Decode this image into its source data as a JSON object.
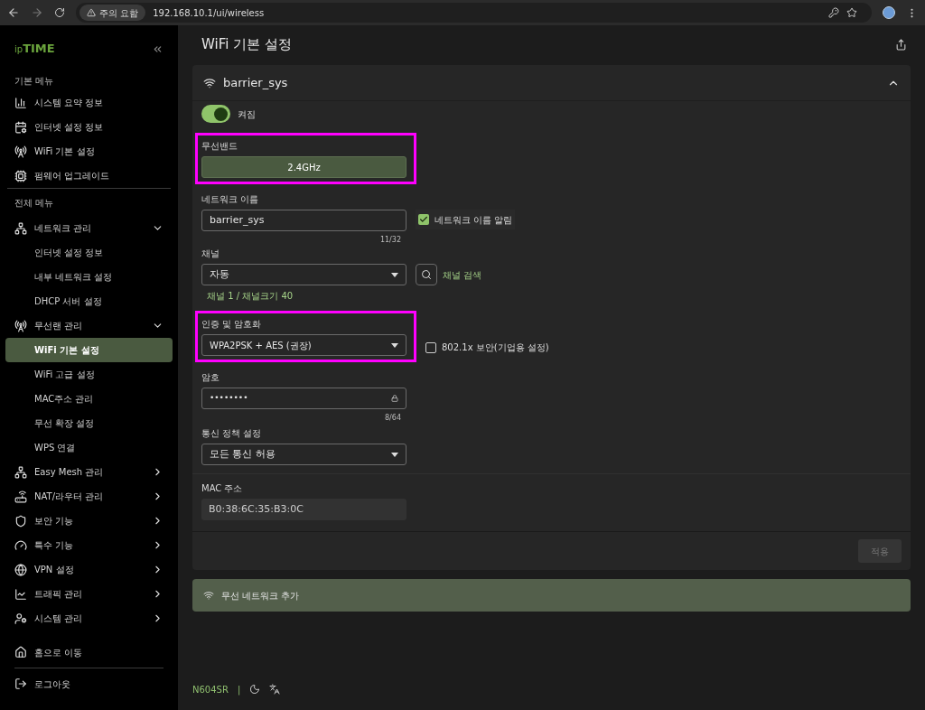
{
  "browser": {
    "warning": "주의 요함",
    "url": "192.168.10.1/ui/wireless"
  },
  "sidebar": {
    "logo_prefix": "ip",
    "logo": "TIME",
    "sections": [
      {
        "title": "기본 메뉴",
        "items": [
          {
            "label": "시스템 요약 정보",
            "selected": false
          },
          {
            "label": "인터넷 설정 정보",
            "selected": false
          },
          {
            "label": "WiFi 기본 설정",
            "selected": false
          },
          {
            "label": "펌웨어 업그레이드",
            "selected": false
          }
        ]
      },
      {
        "title": "전체 메뉴",
        "items": [
          {
            "label": "네트워크 관리",
            "selected": false,
            "expanded": true,
            "children": [
              {
                "label": "인터넷 설정 정보",
                "selected": false
              },
              {
                "label": "내부 네트워크 설정",
                "selected": false
              },
              {
                "label": "DHCP 서버 설정",
                "selected": false
              }
            ]
          },
          {
            "label": "무선랜 관리",
            "selected": false,
            "expanded": true,
            "children": [
              {
                "label": "WiFi 기본 설정",
                "selected": true
              },
              {
                "label": "WiFi 고급 설정",
                "selected": false
              },
              {
                "label": "MAC주소 관리",
                "selected": false
              },
              {
                "label": "무선 확장 설정",
                "selected": false
              },
              {
                "label": "WPS 연결",
                "selected": false
              }
            ]
          },
          {
            "label": "Easy Mesh 관리",
            "selected": false,
            "expanded": false
          },
          {
            "label": "NAT/라우터 관리",
            "selected": false,
            "expanded": false
          },
          {
            "label": "보안 기능",
            "selected": false,
            "expanded": false
          },
          {
            "label": "특수 기능",
            "selected": false,
            "expanded": false
          },
          {
            "label": "VPN 설정",
            "selected": false,
            "expanded": false
          },
          {
            "label": "트래픽 관리",
            "selected": false,
            "expanded": false
          },
          {
            "label": "시스템 관리",
            "selected": false,
            "expanded": false
          }
        ]
      }
    ],
    "bottom": [
      {
        "label": "홈으로 이동"
      },
      {
        "label": "로그아웃"
      }
    ]
  },
  "footer": {
    "model": "N604SR",
    "separator": "|"
  },
  "page": {
    "title": "WiFi 기본 설정"
  },
  "network": {
    "name": "barrier_sys",
    "expanded": true,
    "toggle": {
      "on": true,
      "label": "켜짐"
    },
    "band": {
      "label": "무선밴드",
      "value": "2.4GHz",
      "highlighted": true
    },
    "ssid": {
      "label": "네트워크 이름",
      "value": "barrier_sys",
      "counter": "11/32",
      "broadcast": {
        "label": "네트워크 이름 알림",
        "checked": true
      }
    },
    "channel": {
      "label": "채널",
      "value": "자동",
      "search_label": "채널 검색",
      "info": "채널 1 / 채널크기 40"
    },
    "auth": {
      "label": "인증 및 암호화",
      "value": "WPA2PSK + AES (권장)",
      "highlighted": true,
      "enterprise": {
        "label": "802.1x 보안(기업용 설정)",
        "checked": false
      }
    },
    "password": {
      "label": "암호",
      "value": "••••••••",
      "counter": "8/64"
    },
    "policy": {
      "label": "통신 정책 설정",
      "value": "모든 통신 허용"
    },
    "mac": {
      "label": "MAC 주소",
      "value": "B0:38:6C:35:B3:0C"
    },
    "apply": {
      "label": "적용",
      "disabled": true
    }
  },
  "add_network": {
    "label": "무선 네트워크 추가"
  }
}
